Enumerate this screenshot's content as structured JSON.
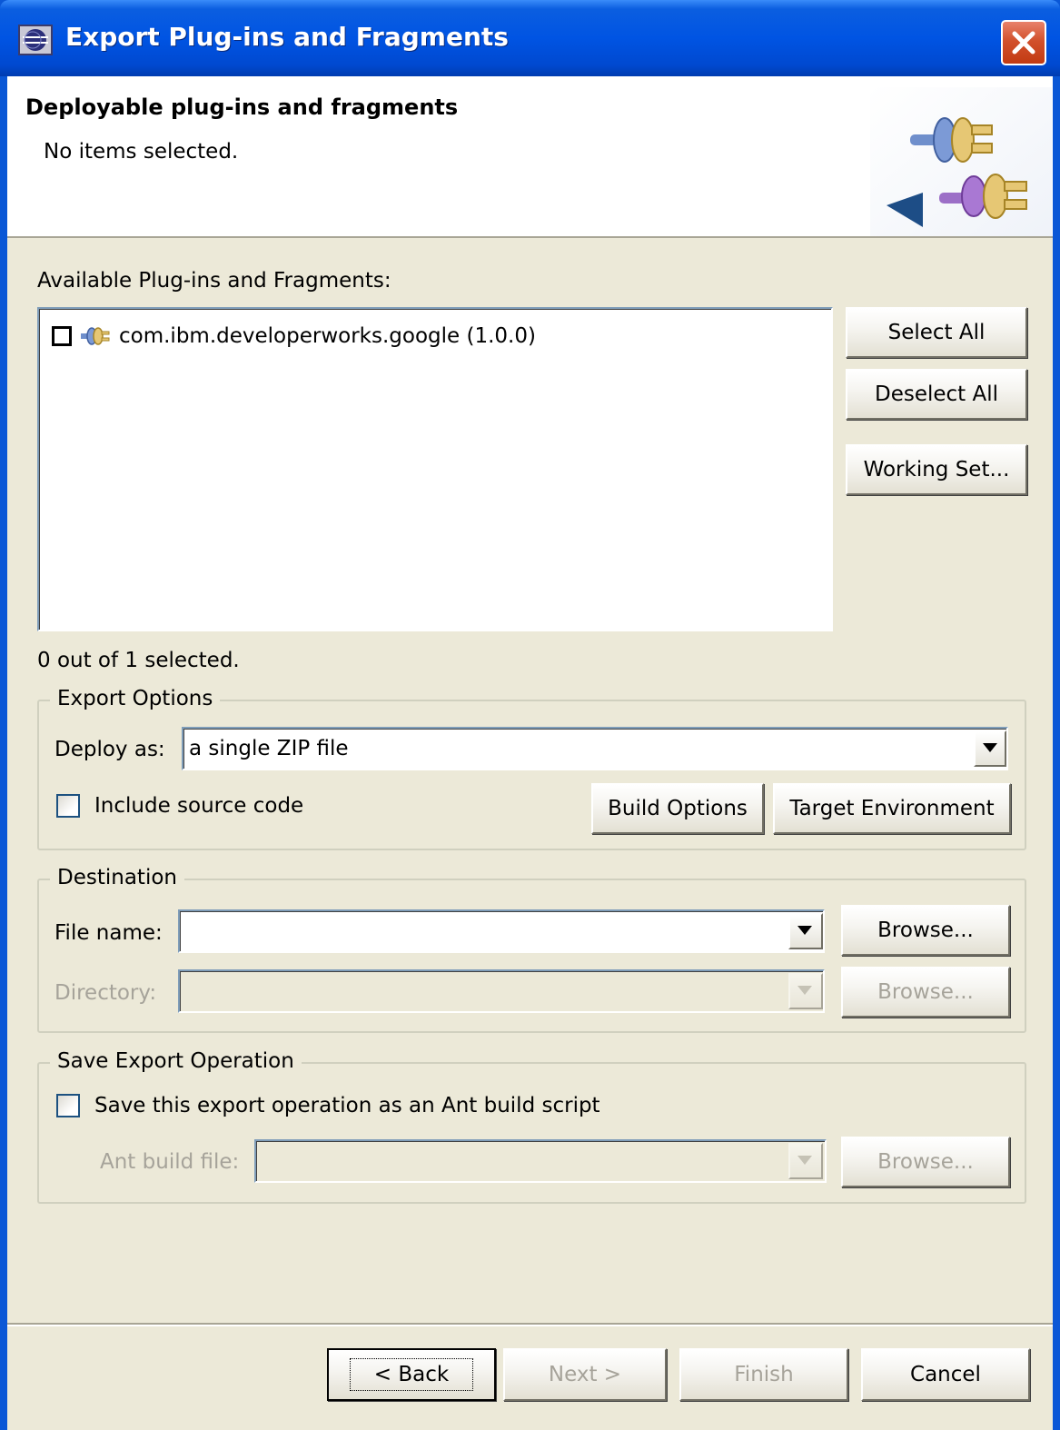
{
  "window": {
    "title": "Export Plug-ins and Fragments"
  },
  "banner": {
    "title": "Deployable plug-ins and fragments",
    "message": "No items selected."
  },
  "plugins": {
    "label": "Available Plug-ins and Fragments:",
    "items": [
      {
        "label": "com.ibm.developerworks.google (1.0.0)",
        "checked": false
      }
    ],
    "count_text": "0 out of 1 selected."
  },
  "list_buttons": {
    "select_all": "Select All",
    "deselect_all": "Deselect All",
    "working_set": "Working Set..."
  },
  "export_options": {
    "group_label": "Export Options",
    "deploy_label": "Deploy as:",
    "deploy_value": "a single ZIP file",
    "include_source_label": "Include source code",
    "include_source_checked": false,
    "build_options": "Build Options",
    "target_environment": "Target Environment"
  },
  "destination": {
    "group_label": "Destination",
    "file_name_label": "File name:",
    "file_name_value": "",
    "file_browse": "Browse...",
    "directory_label": "Directory:",
    "directory_value": "",
    "directory_browse": "Browse..."
  },
  "save_export": {
    "group_label": "Save Export Operation",
    "save_checkbox_label": "Save this export operation as an Ant build script",
    "save_checked": false,
    "ant_file_label": "Ant build file:",
    "ant_file_value": "",
    "ant_browse": "Browse..."
  },
  "footer": {
    "back": "< Back",
    "next": "Next >",
    "finish": "Finish",
    "cancel": "Cancel"
  },
  "colors": {
    "titlebar": "#0054e3",
    "dialog_bg": "#ece9d8",
    "disabled_text": "#a6a39a"
  }
}
